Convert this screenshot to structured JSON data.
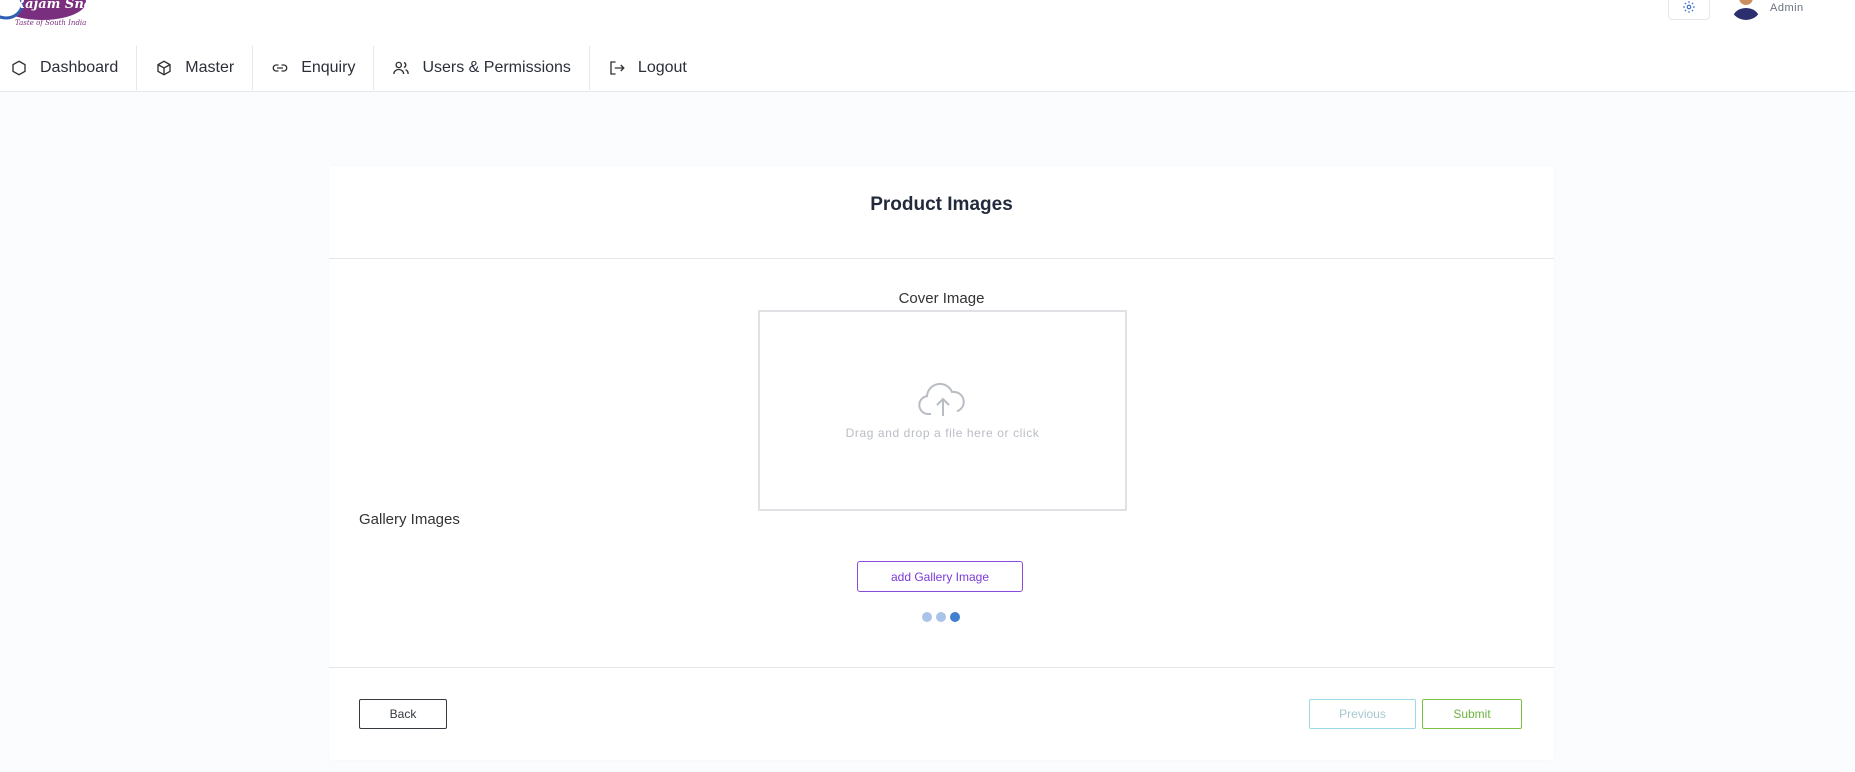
{
  "header": {
    "logo": {
      "text": "Rajam Snacks",
      "tagline": "Taste of South India"
    },
    "user_name": "Admin",
    "icons": {
      "settings": "gear-icon",
      "avatar": "user-avatar"
    }
  },
  "nav": [
    {
      "label": "Dashboard",
      "icon": "hexagon-icon"
    },
    {
      "label": "Master",
      "icon": "box-icon"
    },
    {
      "label": "Enquiry",
      "icon": "link-icon"
    },
    {
      "label": "Users & Permissions",
      "icon": "users-icon"
    },
    {
      "label": "Logout",
      "icon": "logout-icon"
    }
  ],
  "card": {
    "title": "Product Images",
    "cover_label": "Cover Image",
    "dropzone_text": "Drag and drop a file here or click",
    "gallery_label": "Gallery Images",
    "add_gallery_label": "add Gallery Image",
    "buttons": {
      "back": "Back",
      "previous": "Previous",
      "submit": "Submit"
    }
  },
  "colors": {
    "accent_purple": "#7c3bd6",
    "submit_green": "#6db33f",
    "previous_cyan": "#9bd9e6",
    "loader_dots": [
      "#a9c4e8",
      "#a9c4e8",
      "#3f7fd0"
    ]
  }
}
